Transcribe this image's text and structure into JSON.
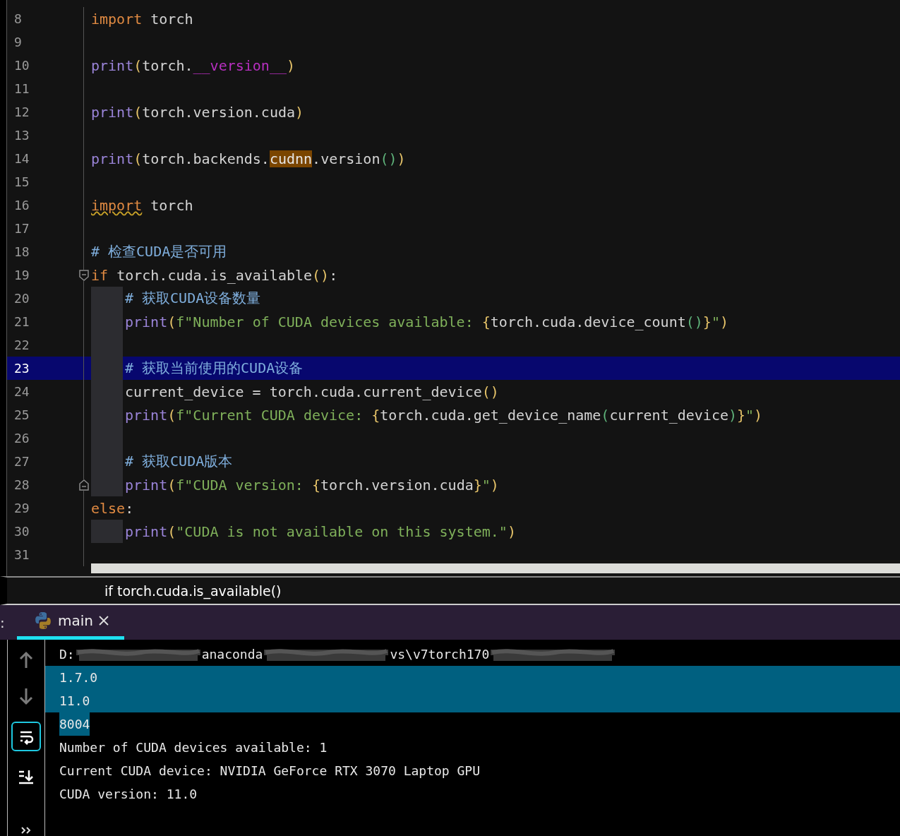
{
  "editor": {
    "lines": [
      {
        "number": "8",
        "current": false,
        "tokens": [
          {
            "kind": "kw",
            "text": "import"
          },
          {
            "kind": "plain",
            "text": " torch"
          }
        ]
      },
      {
        "number": "9",
        "current": false
      },
      {
        "number": "10",
        "current": false,
        "tokens": [
          {
            "kind": "fn",
            "text": "print"
          },
          {
            "kind": "paren",
            "text": "("
          },
          {
            "kind": "plain",
            "text": "torch."
          },
          {
            "kind": "dunder",
            "text": "__version__"
          },
          {
            "kind": "paren",
            "text": ")"
          }
        ]
      },
      {
        "number": "11",
        "current": false
      },
      {
        "number": "12",
        "current": false,
        "tokens": [
          {
            "kind": "fn",
            "text": "print"
          },
          {
            "kind": "paren",
            "text": "("
          },
          {
            "kind": "plain",
            "text": "torch.version.cuda"
          },
          {
            "kind": "paren",
            "text": ")"
          }
        ]
      },
      {
        "number": "13",
        "current": false
      },
      {
        "number": "14",
        "current": false,
        "tokens": [
          {
            "kind": "fn",
            "text": "print"
          },
          {
            "kind": "paren",
            "text": "("
          },
          {
            "kind": "plain",
            "text": "torch.backends."
          },
          {
            "kind": "hl",
            "text": "cudnn"
          },
          {
            "kind": "plain",
            "text": ".version"
          },
          {
            "kind": "inner",
            "text": "()"
          },
          {
            "kind": "paren",
            "text": ")"
          }
        ]
      },
      {
        "number": "15",
        "current": false
      },
      {
        "number": "16",
        "current": false,
        "tokens": [
          {
            "kind": "warn",
            "text": "import"
          },
          {
            "kind": "plain",
            "text": " torch"
          }
        ]
      },
      {
        "number": "17",
        "current": false
      },
      {
        "number": "18",
        "current": false,
        "tokens": [
          {
            "kind": "comment",
            "text": "# 检查CUDA是否可用"
          }
        ]
      },
      {
        "number": "19",
        "current": false,
        "tokens": [
          {
            "kind": "kw",
            "text": "if"
          },
          {
            "kind": "plain",
            "text": " torch.cuda.is_available"
          },
          {
            "kind": "paren",
            "text": "()"
          },
          {
            "kind": "plain",
            "text": ":"
          }
        ],
        "children": [
          {
            "number": "20",
            "current": false,
            "tokens": [
              {
                "kind": "comment",
                "text": "# 获取CUDA设备数量"
              }
            ]
          },
          {
            "number": "21",
            "current": false,
            "tokens": [
              {
                "kind": "fn",
                "text": "print"
              },
              {
                "kind": "paren",
                "text": "("
              },
              {
                "kind": "str",
                "text": "f\"Number of CUDA devices available: "
              },
              {
                "kind": "brace",
                "text": "{"
              },
              {
                "kind": "plain",
                "text": "torch.cuda.device_count"
              },
              {
                "kind": "inner",
                "text": "()"
              },
              {
                "kind": "brace",
                "text": "}"
              },
              {
                "kind": "str",
                "text": "\""
              },
              {
                "kind": "paren",
                "text": ")"
              }
            ]
          },
          {
            "number": "22",
            "current": false
          },
          {
            "number": "23",
            "current": true,
            "tokens": [
              {
                "kind": "comment",
                "text": "# 获取当前使用的CUDA设备"
              }
            ]
          },
          {
            "number": "24",
            "current": false,
            "tokens": [
              {
                "kind": "plain",
                "text": "current_device = torch.cuda.current_device"
              },
              {
                "kind": "paren",
                "text": "()"
              }
            ]
          },
          {
            "number": "25",
            "current": false,
            "tokens": [
              {
                "kind": "fn",
                "text": "print"
              },
              {
                "kind": "paren",
                "text": "("
              },
              {
                "kind": "str",
                "text": "f\"Current CUDA device: "
              },
              {
                "kind": "brace",
                "text": "{"
              },
              {
                "kind": "plain",
                "text": "torch.cuda.get_device_name"
              },
              {
                "kind": "inner",
                "text": "("
              },
              {
                "kind": "plain",
                "text": "current_device"
              },
              {
                "kind": "inner",
                "text": ")"
              },
              {
                "kind": "brace",
                "text": "}"
              },
              {
                "kind": "str",
                "text": "\""
              },
              {
                "kind": "paren",
                "text": ")"
              }
            ]
          },
          {
            "number": "26",
            "current": false
          },
          {
            "number": "27",
            "current": false,
            "tokens": [
              {
                "kind": "comment",
                "text": "# 获取CUDA版本"
              }
            ]
          },
          {
            "number": "28",
            "current": false,
            "tokens": [
              {
                "kind": "fn",
                "text": "print"
              },
              {
                "kind": "paren",
                "text": "("
              },
              {
                "kind": "str",
                "text": "f\"CUDA version: "
              },
              {
                "kind": "brace",
                "text": "{"
              },
              {
                "kind": "plain",
                "text": "torch.version.cuda"
              },
              {
                "kind": "brace",
                "text": "}"
              },
              {
                "kind": "str",
                "text": "\""
              },
              {
                "kind": "paren",
                "text": ")"
              }
            ]
          }
        ]
      },
      {
        "number": "29",
        "current": false,
        "tokens": [
          {
            "kind": "kw",
            "text": "else"
          },
          {
            "kind": "plain",
            "text": ":"
          }
        ],
        "children": [
          {
            "number": "30",
            "current": false,
            "tokens": [
              {
                "kind": "fn",
                "text": "print"
              },
              {
                "kind": "paren",
                "text": "("
              },
              {
                "kind": "str",
                "text": "\"CUDA is not available on this system.\""
              },
              {
                "kind": "paren",
                "text": ")"
              }
            ]
          }
        ]
      },
      {
        "number": "31",
        "current": false
      }
    ]
  },
  "breadcrumb": "if torch.cuda.is_available()",
  "run_panel": {
    "label": ":",
    "tabs": [
      {
        "label": "main",
        "selected": true
      }
    ],
    "output": [
      {
        "selected": false,
        "parts": [
          {
            "kind": "text",
            "text": "D:"
          },
          {
            "kind": "redacted"
          },
          {
            "kind": "text",
            "text": "anaconda"
          },
          {
            "kind": "redacted"
          },
          {
            "kind": "text",
            "text": "vs\\v7torch170"
          },
          {
            "kind": "redacted"
          }
        ]
      },
      {
        "selected": true,
        "parts": [
          {
            "kind": "text",
            "text": "1.7.0"
          }
        ]
      },
      {
        "selected": true,
        "parts": [
          {
            "kind": "text",
            "text": "11.0"
          }
        ]
      },
      {
        "selected": true,
        "parts": [
          {
            "kind": "text",
            "text": "8004"
          }
        ]
      },
      {
        "selected": false,
        "parts": [
          {
            "kind": "text",
            "text": "Number of CUDA devices available: 1"
          }
        ]
      },
      {
        "selected": false,
        "parts": [
          {
            "kind": "text",
            "text": "Current CUDA device: NVIDIA GeForce RTX 3070 Laptop GPU"
          }
        ]
      },
      {
        "selected": false,
        "parts": [
          {
            "kind": "text",
            "text": "CUDA version: 11.0"
          }
        ]
      }
    ],
    "tools": [
      {
        "kind": "up",
        "on": false
      },
      {
        "kind": "down",
        "on": false
      },
      {
        "kind": "wrap",
        "on": true
      },
      {
        "kind": "scroll-end",
        "on": false
      },
      {
        "kind": "more",
        "on": false
      }
    ]
  }
}
